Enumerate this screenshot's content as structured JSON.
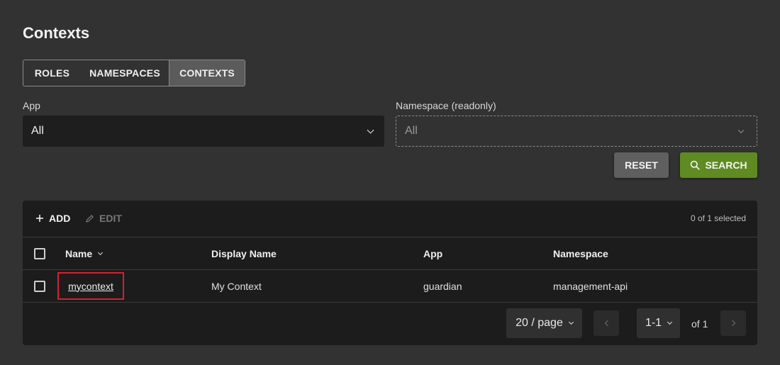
{
  "page": {
    "title": "Contexts"
  },
  "tabs": [
    {
      "label": "ROLES",
      "active": false
    },
    {
      "label": "NAMESPACES",
      "active": false
    },
    {
      "label": "CONTEXTS",
      "active": true
    }
  ],
  "filters": {
    "app": {
      "label": "App",
      "value": "All"
    },
    "namespace": {
      "label": "Namespace (readonly)",
      "value": "All"
    }
  },
  "actions": {
    "reset_label": "RESET",
    "search_label": "SEARCH"
  },
  "toolbar": {
    "add_label": "ADD",
    "edit_label": "EDIT",
    "selected_text": "0 of 1 selected"
  },
  "table": {
    "columns": [
      "Name",
      "Display Name",
      "App",
      "Namespace"
    ],
    "rows": [
      {
        "name": "mycontext",
        "display_name": "My Context",
        "app": "guardian",
        "namespace": "management-api"
      }
    ]
  },
  "pagination": {
    "per_page": "20 / page",
    "page_range": "1-1",
    "of_text": "of 1"
  },
  "colors": {
    "background": "#323232",
    "panel": "#1c1c1c",
    "search_button": "#5f8b22",
    "highlight": "#d61f35"
  },
  "icons": {
    "add": "plus-icon",
    "edit": "pencil-icon",
    "search": "search-icon"
  }
}
